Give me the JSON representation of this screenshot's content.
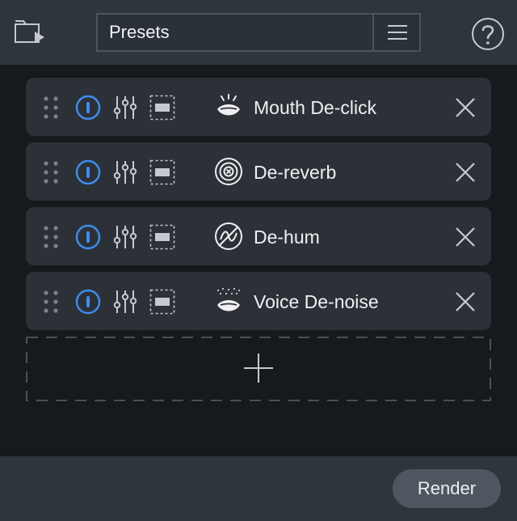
{
  "header": {
    "preset_label": "Presets",
    "icons": {
      "open": "folder-play-icon",
      "menu": "hamburger-menu-icon",
      "help": "question-icon"
    }
  },
  "modules": [
    {
      "name": "Mouth De-click",
      "icon": "mouth-click-icon"
    },
    {
      "name": "De-reverb",
      "icon": "de-reverb-icon"
    },
    {
      "name": "De-hum",
      "icon": "de-hum-icon"
    },
    {
      "name": "Voice De-noise",
      "icon": "voice-denoise-icon"
    }
  ],
  "module_controls": {
    "grip_icon": "drag-handle-icon",
    "power_icon": "power-toggle-icon",
    "settings_icon": "sliders-icon",
    "region_icon": "region-select-icon",
    "remove_icon": "close-icon"
  },
  "add_module_icon": "plus-icon",
  "footer": {
    "render_label": "Render"
  },
  "colors": {
    "accent": "#3d8ef0",
    "panel": "#2c3138",
    "header": "#2f353d",
    "background": "#16191d"
  }
}
